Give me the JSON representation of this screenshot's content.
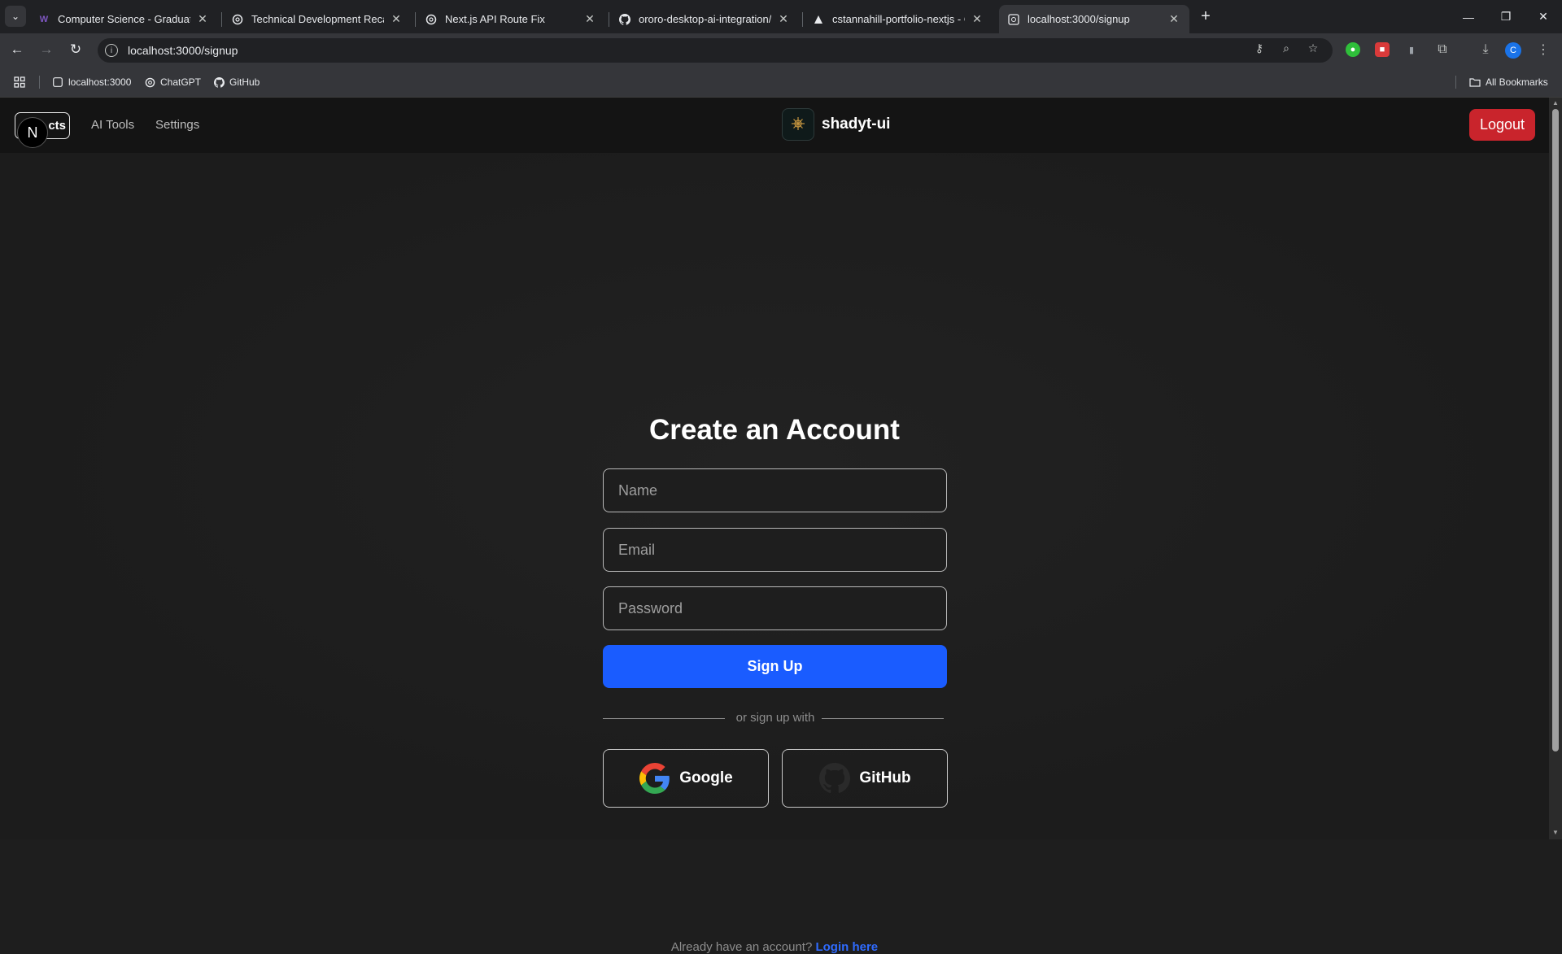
{
  "browser": {
    "tabs": [
      {
        "title": "Computer Science - Graduate P",
        "favicon": "W",
        "active": false
      },
      {
        "title": "Technical Development Recap",
        "favicon": "chatgpt-icon",
        "active": false
      },
      {
        "title": "Next.js API Route Fix",
        "favicon": "chatgpt-icon",
        "active": false
      },
      {
        "title": "ororo-desktop-ai-integration/R",
        "favicon": "github-icon",
        "active": false
      },
      {
        "title": "cstannahill-portfolio-nextjs - O",
        "favicon": "vercel-icon",
        "active": false
      },
      {
        "title": "localhost:3000/signup",
        "favicon": "nextjs-icon",
        "active": true
      }
    ],
    "url": "localhost:3000/signup",
    "profile_initial": "C",
    "bookmarks": [
      {
        "label": "localhost:3000"
      },
      {
        "label": "ChatGPT"
      },
      {
        "label": "GitHub"
      }
    ],
    "all_bookmarks_label": "All Bookmarks"
  },
  "app": {
    "nav": {
      "projects_label": "cts",
      "nextjs_badge": "N",
      "links": [
        "AI Tools",
        "Settings"
      ],
      "brand": "shadyt-ui",
      "logout_label": "Logout"
    },
    "form": {
      "title": "Create an Account",
      "name_placeholder": "Name",
      "email_placeholder": "Email",
      "password_placeholder": "Password",
      "submit_label": "Sign Up",
      "divider_text": "or sign up with",
      "google_label": "Google",
      "github_label": "GitHub",
      "footer_prefix": "Already have an account?",
      "footer_link": "Login here"
    }
  },
  "colors": {
    "accent": "#1a5cff",
    "logout": "#c9242c",
    "link": "#2f6bff"
  }
}
